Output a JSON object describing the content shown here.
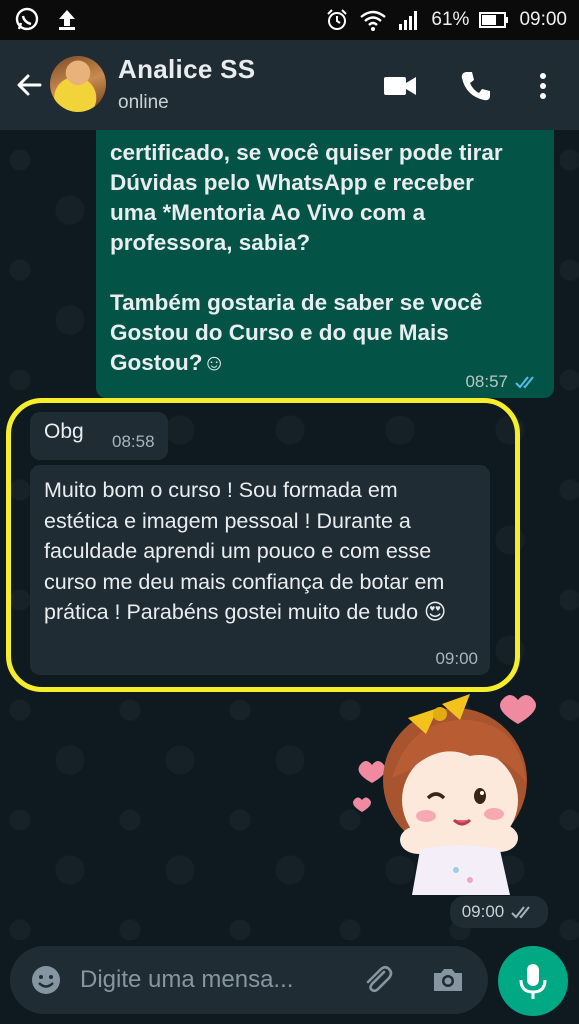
{
  "status_bar": {
    "battery": "61%",
    "time": "09:00"
  },
  "header": {
    "contact_name": "Analice SS",
    "contact_status": "online"
  },
  "messages": {
    "outgoing": {
      "text": "certificado, se você quiser pode tirar\nDúvidas pelo WhatsApp e receber\numa *Mentoria Ao Vivo com a\nprofessora, sabia?\n\nTambém gostaria de saber se você\nGostou do Curso e do que Mais\nGostou?☺",
      "time": "08:57"
    },
    "incoming_1": {
      "text": "Obg",
      "time": "08:58"
    },
    "incoming_2": {
      "text": "Muito bom o curso ! Sou formada em estética e imagem pessoal ! Durante a faculdade aprendi um pouco e com esse curso me deu mais confiança de botar em prática ! Parabéns gostei muito de tudo 😍",
      "time": "09:00"
    },
    "sticker": {
      "time": "09:00"
    }
  },
  "composer": {
    "placeholder": "Digite uma mensa..."
  },
  "colors": {
    "outgoing_bubble": "#035446",
    "incoming_bubble": "#1f2c34",
    "highlight": "#f6ee2a",
    "accent": "#00a884",
    "read_ticks": "#53bdeb"
  },
  "icons": [
    "whatsapp-icon",
    "upload-icon",
    "alarm-icon",
    "wifi-icon",
    "signal-icon",
    "battery-icon",
    "back-arrow-icon",
    "video-call-icon",
    "phone-icon",
    "more-vertical-icon",
    "double-check-icon",
    "emoji-icon",
    "paperclip-icon",
    "camera-icon",
    "mic-icon"
  ]
}
